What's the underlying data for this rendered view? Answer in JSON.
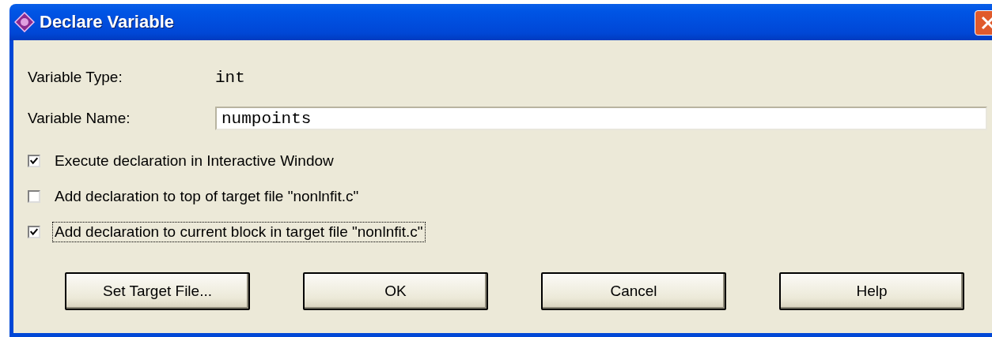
{
  "window": {
    "title": "Declare Variable"
  },
  "fields": [
    {
      "kind": "static",
      "label": "Variable Type:",
      "value": "int"
    },
    {
      "kind": "input",
      "label": "Variable Name:",
      "value": "numpoints"
    }
  ],
  "options": [
    {
      "label": "Execute declaration in Interactive Window",
      "checked": true,
      "focused": false
    },
    {
      "label": "Add declaration to top of target file \"nonlnfit.c\"",
      "checked": false,
      "focused": false
    },
    {
      "label": "Add declaration to current block in target file \"nonlnfit.c\"",
      "checked": true,
      "focused": true
    }
  ],
  "buttons": [
    "Set Target File...",
    "OK",
    "Cancel",
    "Help"
  ]
}
